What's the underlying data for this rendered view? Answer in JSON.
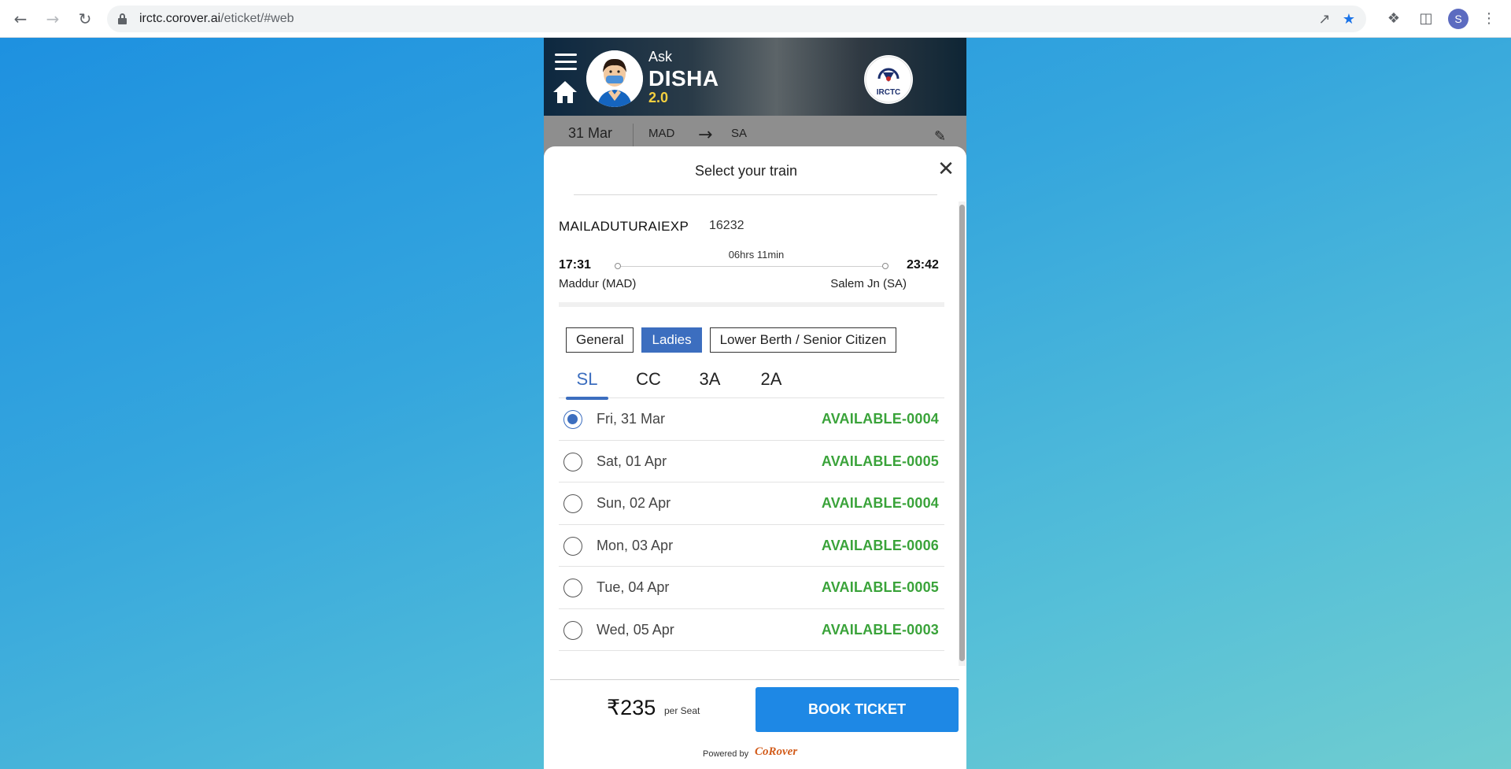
{
  "browser": {
    "url_host": "irctc.corover.ai",
    "url_path": "/eticket/#web",
    "profile_initial": "S",
    "icons": {
      "back": "back-arrow-icon",
      "forward": "forward-arrow-icon",
      "reload": "reload-icon",
      "lock": "lock-icon",
      "share": "share-icon",
      "bookmark": "star-icon",
      "extensions": "puzzle-icon",
      "side_panel": "side-panel-icon",
      "menu": "kebab-menu-icon"
    },
    "colors": {
      "bookmark_star": "#1a73e8",
      "avatar": "#5c6bc0"
    }
  },
  "app": {
    "header": {
      "ask": "Ask",
      "name": "DISHA",
      "version": "2.0",
      "logo_text": "IRCTC"
    },
    "journey": {
      "date": "31 Mar",
      "from_code": "MAD",
      "to_code": "SA"
    },
    "sheet": {
      "title": "Select your train",
      "close": "✕"
    },
    "train": {
      "name": "MAILADUTURAIEXP",
      "number": "16232",
      "departure_time": "17:31",
      "arrival_time": "23:42",
      "duration": "06hrs 11min",
      "from_station": "Maddur (MAD)",
      "to_station": "Salem Jn (SA)"
    },
    "quotas": {
      "general": "General",
      "ladies": "Ladies",
      "lower_berth": "Lower Berth / Senior Citizen",
      "selected": "Ladies"
    },
    "classes": {
      "sl": "SL",
      "cc": "CC",
      "a3": "3A",
      "a2": "2A",
      "selected": "SL"
    },
    "availability": [
      {
        "date": "Fri, 31 Mar",
        "status": "AVAILABLE-0004",
        "selected": true
      },
      {
        "date": "Sat, 01 Apr",
        "status": "AVAILABLE-0005",
        "selected": false
      },
      {
        "date": "Sun, 02 Apr",
        "status": "AVAILABLE-0004",
        "selected": false
      },
      {
        "date": "Mon, 03 Apr",
        "status": "AVAILABLE-0006",
        "selected": false
      },
      {
        "date": "Tue, 04 Apr",
        "status": "AVAILABLE-0005",
        "selected": false
      },
      {
        "date": "Wed, 05 Apr",
        "status": "AVAILABLE-0003",
        "selected": false
      }
    ],
    "footer": {
      "price": "₹235",
      "per_seat": "per Seat",
      "book_label": "BOOK TICKET",
      "powered_by": "Powered by",
      "brand": "CoRover"
    },
    "colors": {
      "primary_blue": "#3c6ebf",
      "book_button": "#1e88e5",
      "available_green": "#3aa33a"
    }
  }
}
